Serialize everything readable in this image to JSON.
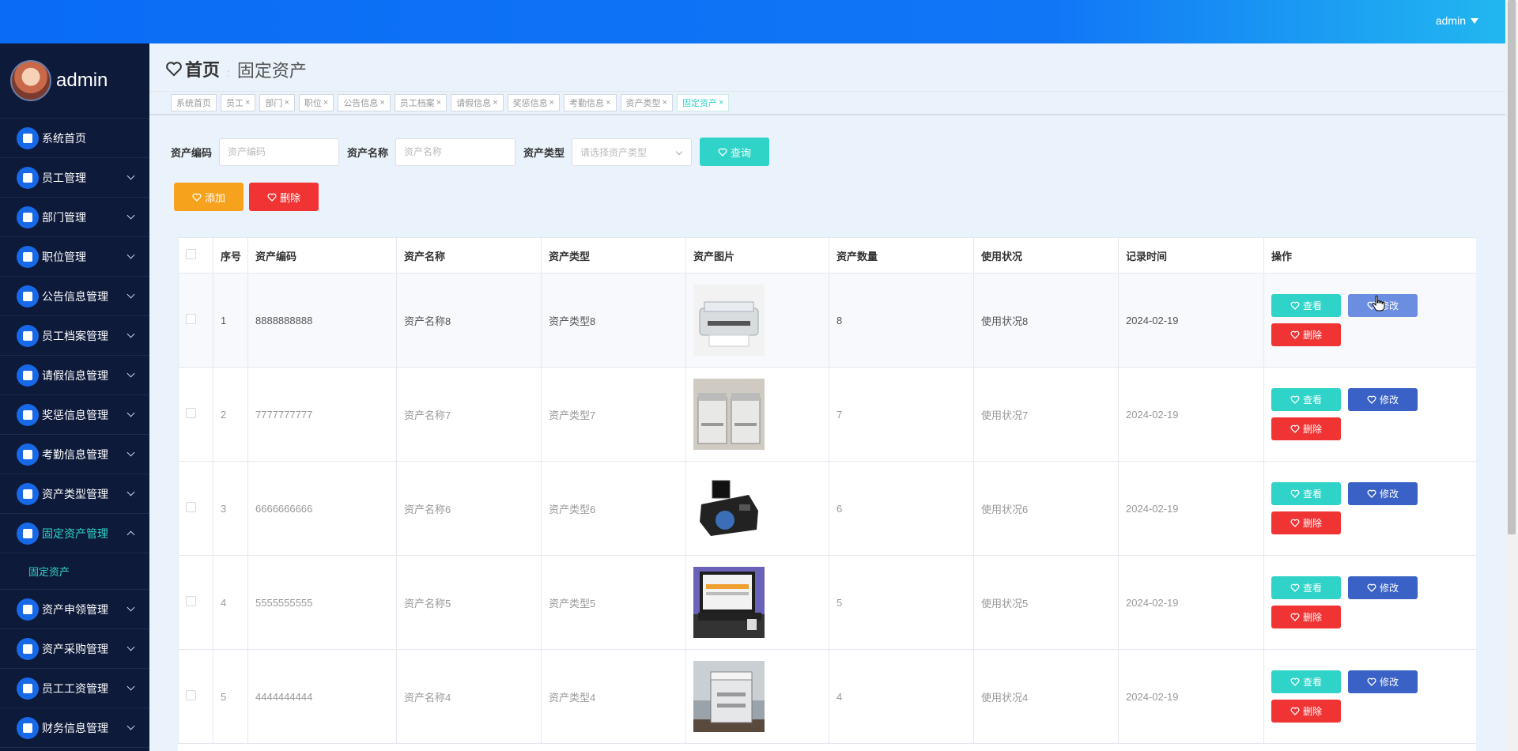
{
  "header": {
    "user": "admin"
  },
  "sidebar": {
    "profile_name": "admin",
    "items": [
      {
        "label": "系统首页",
        "expandable": false
      },
      {
        "label": "员工管理",
        "expandable": true
      },
      {
        "label": "部门管理",
        "expandable": true
      },
      {
        "label": "职位管理",
        "expandable": true
      },
      {
        "label": "公告信息管理",
        "expandable": true
      },
      {
        "label": "员工档案管理",
        "expandable": true
      },
      {
        "label": "请假信息管理",
        "expandable": true
      },
      {
        "label": "奖惩信息管理",
        "expandable": true
      },
      {
        "label": "考勤信息管理",
        "expandable": true
      },
      {
        "label": "资产类型管理",
        "expandable": true
      },
      {
        "label": "固定资产管理",
        "expandable": true,
        "active": true
      },
      {
        "label": "资产申领管理",
        "expandable": true
      },
      {
        "label": "资产采购管理",
        "expandable": true
      },
      {
        "label": "员工工资管理",
        "expandable": true
      },
      {
        "label": "财务信息管理",
        "expandable": true
      }
    ],
    "sub_item": "固定资产"
  },
  "breadcrumb": {
    "home": "首页",
    "current": "固定资产"
  },
  "tags": [
    "系统首页",
    "员工",
    "部门",
    "职位",
    "公告信息",
    "员工档案",
    "请假信息",
    "奖惩信息",
    "考勤信息",
    "资产类型",
    "固定资产"
  ],
  "search": {
    "code_label": "资产编码",
    "code_placeholder": "资产编码",
    "name_label": "资产名称",
    "name_placeholder": "资产名称",
    "type_label": "资产类型",
    "type_placeholder": "请选择资产类型",
    "query_label": "查询"
  },
  "toolbar": {
    "add_label": "添加",
    "delete_label": "删除"
  },
  "table": {
    "columns": [
      "序号",
      "资产编码",
      "资产名称",
      "资产类型",
      "资产图片",
      "资产数量",
      "使用状况",
      "记录时间",
      "操作"
    ],
    "rows": [
      {
        "no": "1",
        "code": "8888888888",
        "name": "资产名称8",
        "type": "资产类型8",
        "qty": "8",
        "status": "使用状况8",
        "time": "2024-02-19"
      },
      {
        "no": "2",
        "code": "7777777777",
        "name": "资产名称7",
        "type": "资产类型7",
        "qty": "7",
        "status": "使用状况7",
        "time": "2024-02-19"
      },
      {
        "no": "3",
        "code": "6666666666",
        "name": "资产名称6",
        "type": "资产类型6",
        "qty": "6",
        "status": "使用状况6",
        "time": "2024-02-19"
      },
      {
        "no": "4",
        "code": "5555555555",
        "name": "资产名称5",
        "type": "资产类型5",
        "qty": "5",
        "status": "使用状况5",
        "time": "2024-02-19"
      },
      {
        "no": "5",
        "code": "4444444444",
        "name": "资产名称4",
        "type": "资产类型4",
        "qty": "4",
        "status": "使用状况4",
        "time": "2024-02-19"
      }
    ],
    "view_label": "查看",
    "edit_label": "修改",
    "remove_label": "删除"
  }
}
